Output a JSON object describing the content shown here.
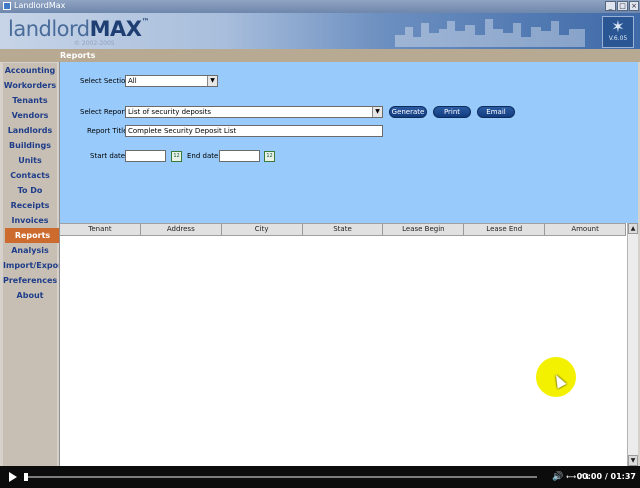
{
  "window": {
    "title": "LandlordMax",
    "min": "_",
    "max": "□",
    "close": "×"
  },
  "header": {
    "logo_part1": "landlord",
    "logo_part2": "MAX",
    "trademark": "™",
    "copyright": "© 2002-2005",
    "version": "V.6.05",
    "star": "✶"
  },
  "section_title": "Reports",
  "sidebar": {
    "items": [
      {
        "label": "Accounting",
        "active": false
      },
      {
        "label": "Workorders",
        "active": false
      },
      {
        "label": "Tenants",
        "active": false
      },
      {
        "label": "Vendors",
        "active": false
      },
      {
        "label": "Landlords",
        "active": false
      },
      {
        "label": "Buildings",
        "active": false
      },
      {
        "label": "Units",
        "active": false
      },
      {
        "label": "Contacts",
        "active": false
      },
      {
        "label": "To Do",
        "active": false
      },
      {
        "label": "Receipts",
        "active": false
      },
      {
        "label": "Invoices",
        "active": false
      },
      {
        "label": "Reports",
        "active": true
      },
      {
        "label": "Analysis",
        "active": false
      },
      {
        "label": "Import/Export",
        "active": false
      },
      {
        "label": "Preferences",
        "active": false
      },
      {
        "label": "About",
        "active": false
      }
    ]
  },
  "form": {
    "select_section_label": "Select Section",
    "select_section_value": "All",
    "select_report_label": "Select Report",
    "select_report_value": "List of security deposits",
    "report_title_label": "Report Title",
    "report_title_value": "Complete Security Deposit List",
    "start_date_label": "Start date",
    "start_date_value": "",
    "end_date_label": "End date",
    "end_date_value": "",
    "calendar_glyph": "12",
    "dropdown_glyph": "▼",
    "generate_label": "Generate",
    "print_label": "Print",
    "email_label": "Email"
  },
  "table": {
    "columns": [
      "Tenant",
      "Address",
      "City",
      "State",
      "Lease Begin",
      "Lease End",
      "Amount"
    ],
    "rows": []
  },
  "scrollbar": {
    "up_glyph": "▲",
    "down_glyph": "▼"
  },
  "player": {
    "time": "00:00 / 01:37",
    "progress": 0.0,
    "volume_icon": "🔊",
    "controls": "⟷ ⤢ ℹ"
  },
  "colors": {
    "accent_active": "#cd6b2e",
    "form_bg": "#98cafc",
    "nav_text": "#1f3d8a"
  }
}
